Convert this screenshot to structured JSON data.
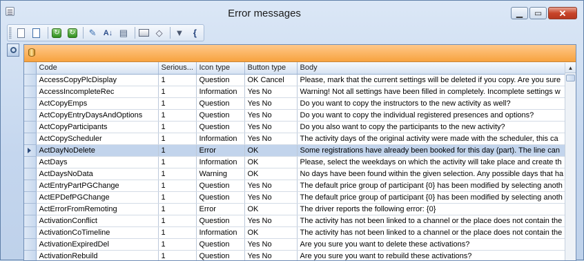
{
  "window": {
    "title": "Error messages"
  },
  "grid": {
    "columns": [
      "Code",
      "Serious...",
      "Icon type",
      "Button type",
      "Body"
    ],
    "rows": [
      {
        "code": "AccessCopyPlcDisplay",
        "serious": "1",
        "icon": "Question",
        "button": "OK Cancel",
        "body": "Please, mark that the current settings will be deleted if you copy. Are you sure"
      },
      {
        "code": "AccessIncompleteRec",
        "serious": "1",
        "icon": "Information",
        "button": "Yes No",
        "body": "Warning! Not all settings have been filled in completely. Incomplete settings w"
      },
      {
        "code": "ActCopyEmps",
        "serious": "1",
        "icon": "Question",
        "button": "Yes No",
        "body": "Do you want to copy the instructors to the new activity as well?"
      },
      {
        "code": "ActCopyEntryDaysAndOptions",
        "serious": "1",
        "icon": "Question",
        "button": "Yes No",
        "body": "Do you want to copy the individual registered presences and options?"
      },
      {
        "code": "ActCopyParticipants",
        "serious": "1",
        "icon": "Question",
        "button": "Yes No",
        "body": "Do you also want to copy the participants to the new activity?"
      },
      {
        "code": "ActCopyScheduler",
        "serious": "1",
        "icon": "Information",
        "button": "Yes No",
        "body": "The activity days of the original activity were made with the scheduler, this ca"
      },
      {
        "code": "ActDayNoDelete",
        "serious": "1",
        "icon": "Error",
        "button": "OK",
        "body": "Some registrations have already been booked for this day (part). The line can"
      },
      {
        "code": "ActDays",
        "serious": "1",
        "icon": "Information",
        "button": "OK",
        "body": "Please, select the weekdays on which the activity will take place and create th"
      },
      {
        "code": "ActDaysNoData",
        "serious": "1",
        "icon": "Warning",
        "button": "OK",
        "body": "No days have been found within the given selection. Any possible days that ha"
      },
      {
        "code": "ActEntryPartPGChange",
        "serious": "1",
        "icon": "Question",
        "button": "Yes No",
        "body": "The default price group of participant {0} has been modified by selecting anoth"
      },
      {
        "code": "ActEPDefPGChange",
        "serious": "1",
        "icon": "Question",
        "button": "Yes No",
        "body": "The default price group of participant {0} has been modified by selecting anoth"
      },
      {
        "code": "ActErrorFromRemoting",
        "serious": "1",
        "icon": "Error",
        "button": "OK",
        "body": "The driver reports the following error: {0}"
      },
      {
        "code": "ActivationConflict",
        "serious": "1",
        "icon": "Question",
        "button": "Yes No",
        "body": "The activity has not been linked to a channel or the place does not contain the"
      },
      {
        "code": "ActivationCoTimeline",
        "serious": "1",
        "icon": "Information",
        "button": "OK",
        "body": "The activity has not been linked to a channel or the place does not contain the"
      },
      {
        "code": "ActivationExpiredDel",
        "serious": "1",
        "icon": "Question",
        "button": "Yes No",
        "body": "Are you sure you want to delete these activations?"
      },
      {
        "code": "ActivationRebuild",
        "serious": "1",
        "icon": "Question",
        "button": "Yes No",
        "body": "Are you sure you want to rebuild these activations?"
      }
    ],
    "selected_row": 6
  },
  "toolbar": {
    "icons": [
      "new-document-icon",
      "edit-document-icon",
      "refresh-icon",
      "refresh-all-icon",
      "properties-icon",
      "sort-az-icon",
      "comment-icon",
      "print-icon",
      "eraser-icon",
      "filter-icon",
      "brace-icon"
    ]
  },
  "colors": {
    "group_bar": "#f7a33f",
    "selection": "#c2d4ec",
    "close_button": "#c8452a"
  }
}
